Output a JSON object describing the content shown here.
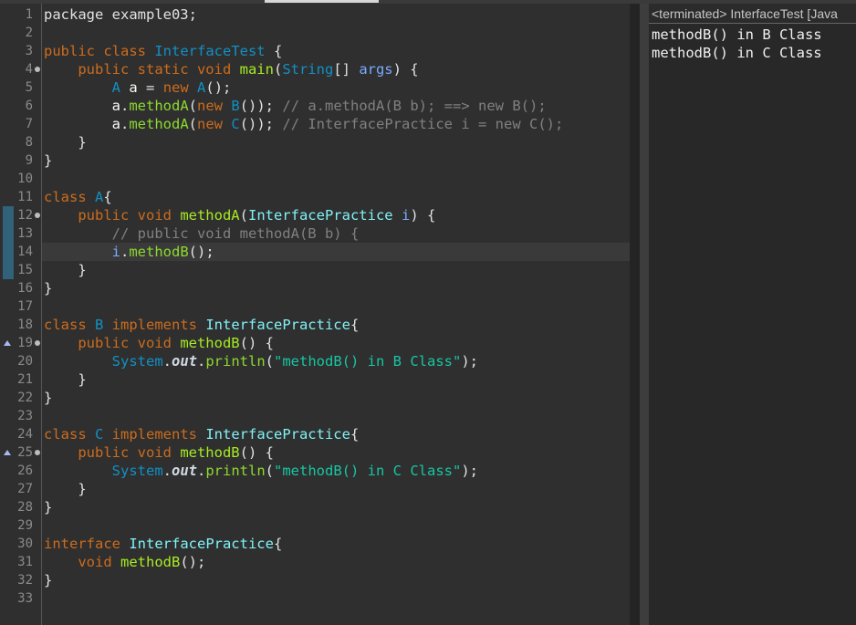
{
  "editor": {
    "line_numbers": [
      "1",
      "2",
      "3",
      "4",
      "5",
      "6",
      "7",
      "8",
      "9",
      "10",
      "11",
      "12",
      "13",
      "14",
      "15",
      "16",
      "17",
      "18",
      "19",
      "20",
      "21",
      "22",
      "23",
      "24",
      "25",
      "26",
      "27",
      "28",
      "29",
      "30",
      "31",
      "32",
      "33"
    ],
    "current_line": "14",
    "code": [
      {
        "n": "1",
        "parts": [
          {
            "c": "d",
            "t": "package example03;"
          }
        ]
      },
      {
        "n": "2",
        "parts": []
      },
      {
        "n": "3",
        "parts": [
          {
            "c": "k",
            "t": "public class "
          },
          {
            "c": "t",
            "t": "InterfaceTest"
          },
          {
            "c": "d",
            "t": " {"
          }
        ]
      },
      {
        "n": "4",
        "parts": [
          {
            "c": "d",
            "t": "    "
          },
          {
            "c": "k",
            "t": "public static void "
          },
          {
            "c": "m",
            "t": "main"
          },
          {
            "c": "d",
            "t": "("
          },
          {
            "c": "t",
            "t": "String"
          },
          {
            "c": "d",
            "t": "[] "
          },
          {
            "c": "v",
            "t": "args"
          },
          {
            "c": "d",
            "t": ") {"
          }
        ]
      },
      {
        "n": "5",
        "parts": [
          {
            "c": "d",
            "t": "        "
          },
          {
            "c": "t",
            "t": "A"
          },
          {
            "c": "d",
            "t": " "
          },
          {
            "c": "p",
            "t": "a"
          },
          {
            "c": "d",
            "t": " = "
          },
          {
            "c": "k",
            "t": "new "
          },
          {
            "c": "t",
            "t": "A"
          },
          {
            "c": "d",
            "t": "();"
          }
        ]
      },
      {
        "n": "6",
        "parts": [
          {
            "c": "d",
            "t": "        "
          },
          {
            "c": "p",
            "t": "a"
          },
          {
            "c": "d",
            "t": "."
          },
          {
            "c": "f",
            "t": "methodA"
          },
          {
            "c": "d",
            "t": "("
          },
          {
            "c": "k",
            "t": "new "
          },
          {
            "c": "t",
            "t": "B"
          },
          {
            "c": "d",
            "t": "()); "
          },
          {
            "c": "c",
            "t": "// a.methodA(B b); ==> new B();"
          }
        ]
      },
      {
        "n": "7",
        "parts": [
          {
            "c": "d",
            "t": "        "
          },
          {
            "c": "p",
            "t": "a"
          },
          {
            "c": "d",
            "t": "."
          },
          {
            "c": "f",
            "t": "methodA"
          },
          {
            "c": "d",
            "t": "("
          },
          {
            "c": "k",
            "t": "new "
          },
          {
            "c": "t",
            "t": "C"
          },
          {
            "c": "d",
            "t": "()); "
          },
          {
            "c": "c",
            "t": "// InterfacePractice i = new C();"
          }
        ]
      },
      {
        "n": "8",
        "parts": [
          {
            "c": "d",
            "t": "    }"
          }
        ]
      },
      {
        "n": "9",
        "parts": [
          {
            "c": "d",
            "t": "}"
          }
        ]
      },
      {
        "n": "10",
        "parts": []
      },
      {
        "n": "11",
        "parts": [
          {
            "c": "k",
            "t": "class "
          },
          {
            "c": "t",
            "t": "A"
          },
          {
            "c": "d",
            "t": "{"
          }
        ]
      },
      {
        "n": "12",
        "parts": [
          {
            "c": "d",
            "t": "    "
          },
          {
            "c": "k",
            "t": "public void "
          },
          {
            "c": "m",
            "t": "methodA"
          },
          {
            "c": "d",
            "t": "("
          },
          {
            "c": "g",
            "t": "InterfacePractice"
          },
          {
            "c": "d",
            "t": " "
          },
          {
            "c": "v",
            "t": "i"
          },
          {
            "c": "d",
            "t": ") {"
          }
        ]
      },
      {
        "n": "13",
        "parts": [
          {
            "c": "d",
            "t": "        "
          },
          {
            "c": "c",
            "t": "// public void methodA(B b) {"
          }
        ]
      },
      {
        "n": "14",
        "parts": [
          {
            "c": "d",
            "t": "        "
          },
          {
            "c": "v",
            "t": "i"
          },
          {
            "c": "d",
            "t": "."
          },
          {
            "c": "f",
            "t": "methodB"
          },
          {
            "c": "d",
            "t": "();"
          }
        ]
      },
      {
        "n": "15",
        "parts": [
          {
            "c": "d",
            "t": "    }"
          }
        ]
      },
      {
        "n": "16",
        "parts": [
          {
            "c": "d",
            "t": "}"
          }
        ]
      },
      {
        "n": "17",
        "parts": []
      },
      {
        "n": "18",
        "parts": [
          {
            "c": "k",
            "t": "class "
          },
          {
            "c": "t",
            "t": "B"
          },
          {
            "c": "k",
            "t": " implements "
          },
          {
            "c": "g",
            "t": "InterfacePractice"
          },
          {
            "c": "d",
            "t": "{"
          }
        ]
      },
      {
        "n": "19",
        "parts": [
          {
            "c": "d",
            "t": "    "
          },
          {
            "c": "k",
            "t": "public void "
          },
          {
            "c": "m",
            "t": "methodB"
          },
          {
            "c": "d",
            "t": "() {"
          }
        ]
      },
      {
        "n": "20",
        "parts": [
          {
            "c": "d",
            "t": "        "
          },
          {
            "c": "t",
            "t": "System"
          },
          {
            "c": "d",
            "t": "."
          },
          {
            "c": "st",
            "t": "out"
          },
          {
            "c": "d",
            "t": "."
          },
          {
            "c": "f",
            "t": "println"
          },
          {
            "c": "d",
            "t": "("
          },
          {
            "c": "s",
            "t": "\"methodB() in B Class\""
          },
          {
            "c": "d",
            "t": ");"
          }
        ]
      },
      {
        "n": "21",
        "parts": [
          {
            "c": "d",
            "t": "    }"
          }
        ]
      },
      {
        "n": "22",
        "parts": [
          {
            "c": "d",
            "t": "}"
          }
        ]
      },
      {
        "n": "23",
        "parts": []
      },
      {
        "n": "24",
        "parts": [
          {
            "c": "k",
            "t": "class "
          },
          {
            "c": "t",
            "t": "C"
          },
          {
            "c": "k",
            "t": " implements "
          },
          {
            "c": "g",
            "t": "InterfacePractice"
          },
          {
            "c": "d",
            "t": "{"
          }
        ]
      },
      {
        "n": "25",
        "parts": [
          {
            "c": "d",
            "t": "    "
          },
          {
            "c": "k",
            "t": "public void "
          },
          {
            "c": "m",
            "t": "methodB"
          },
          {
            "c": "d",
            "t": "() {"
          }
        ]
      },
      {
        "n": "26",
        "parts": [
          {
            "c": "d",
            "t": "        "
          },
          {
            "c": "t",
            "t": "System"
          },
          {
            "c": "d",
            "t": "."
          },
          {
            "c": "st",
            "t": "out"
          },
          {
            "c": "d",
            "t": "."
          },
          {
            "c": "f",
            "t": "println"
          },
          {
            "c": "d",
            "t": "("
          },
          {
            "c": "s",
            "t": "\"methodB() in C Class\""
          },
          {
            "c": "d",
            "t": ");"
          }
        ]
      },
      {
        "n": "27",
        "parts": [
          {
            "c": "d",
            "t": "    }"
          }
        ]
      },
      {
        "n": "28",
        "parts": [
          {
            "c": "d",
            "t": "}"
          }
        ]
      },
      {
        "n": "29",
        "parts": []
      },
      {
        "n": "30",
        "parts": [
          {
            "c": "k",
            "t": "interface "
          },
          {
            "c": "g",
            "t": "InterfacePractice"
          },
          {
            "c": "d",
            "t": "{"
          }
        ]
      },
      {
        "n": "31",
        "parts": [
          {
            "c": "d",
            "t": "    "
          },
          {
            "c": "k",
            "t": "void "
          },
          {
            "c": "m",
            "t": "methodB"
          },
          {
            "c": "d",
            "t": "();"
          }
        ]
      },
      {
        "n": "32",
        "parts": [
          {
            "c": "d",
            "t": "}"
          }
        ]
      },
      {
        "n": "33",
        "parts": []
      }
    ],
    "fold_lines": [
      "4",
      "12",
      "19",
      "25"
    ],
    "override_lines": [
      "19",
      "25"
    ]
  },
  "console": {
    "header": "<terminated> InterfaceTest [Java",
    "output": [
      "methodB() in B Class",
      "methodB() in C Class"
    ]
  },
  "colors": {
    "background": "#2f2f2f",
    "keyword": "#cc6c1d",
    "type": "#1290c3",
    "method": "#a7ec21",
    "comment": "#808080",
    "string": "#17c6a3"
  }
}
